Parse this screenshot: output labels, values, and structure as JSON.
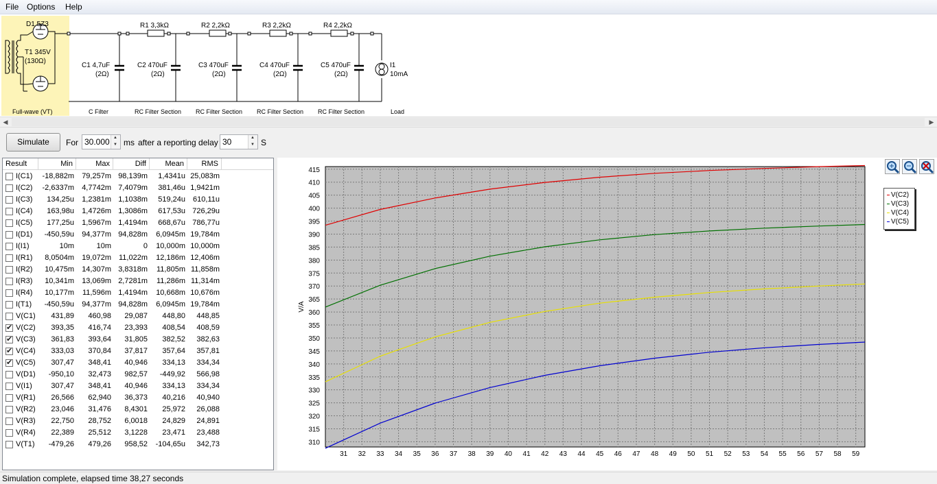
{
  "menu": {
    "items": [
      "File",
      "Options",
      "Help"
    ]
  },
  "schematic": {
    "rectifier": {
      "diode": "D1 5Z3",
      "transformer": "T1 345V",
      "transformer_r": "(130Ω)",
      "caption": "Full-wave (VT)"
    },
    "c1": {
      "name": "C1 4,7uF",
      "esr": "(2Ω)",
      "caption": "C Filter"
    },
    "sections": [
      {
        "resistor": "R1 3,3kΩ",
        "cap": "C2 470uF",
        "esr": "(2Ω)",
        "caption": "RC Filter Section"
      },
      {
        "resistor": "R2 2,2kΩ",
        "cap": "C3 470uF",
        "esr": "(2Ω)",
        "caption": "RC Filter Section"
      },
      {
        "resistor": "R3 2,2kΩ",
        "cap": "C4 470uF",
        "esr": "(2Ω)",
        "caption": "RC Filter Section"
      },
      {
        "resistor": "R4 2,2kΩ",
        "cap": "C5 470uF",
        "esr": "(2Ω)",
        "caption": "RC Filter Section"
      }
    ],
    "load": {
      "name": "I1",
      "value": "10mA",
      "caption": "Load"
    }
  },
  "toolbar": {
    "simulate_label": "Simulate",
    "for_label": "For",
    "duration_value": "30.000",
    "duration_unit": "ms",
    "delay_label": "after a reporting delay of",
    "delay_value": "30",
    "delay_unit": "S"
  },
  "table": {
    "columns": [
      "Result",
      "Min",
      "Max",
      "Diff",
      "Mean",
      "RMS"
    ],
    "rows": [
      {
        "name": "I(C1)",
        "min": "-18,882m",
        "max": "79,257m",
        "diff": "98,139m",
        "mean": "1,4341u",
        "rms": "25,083m",
        "checked": false
      },
      {
        "name": "I(C2)",
        "min": "-2,6337m",
        "max": "4,7742m",
        "diff": "7,4079m",
        "mean": "381,46u",
        "rms": "1,9421m",
        "checked": false
      },
      {
        "name": "I(C3)",
        "min": "134,25u",
        "max": "1,2381m",
        "diff": "1,1038m",
        "mean": "519,24u",
        "rms": "610,11u",
        "checked": false
      },
      {
        "name": "I(C4)",
        "min": "163,98u",
        "max": "1,4726m",
        "diff": "1,3086m",
        "mean": "617,53u",
        "rms": "726,29u",
        "checked": false
      },
      {
        "name": "I(C5)",
        "min": "177,25u",
        "max": "1,5967m",
        "diff": "1,4194m",
        "mean": "668,67u",
        "rms": "786,77u",
        "checked": false
      },
      {
        "name": "I(D1)",
        "min": "-450,59u",
        "max": "94,377m",
        "diff": "94,828m",
        "mean": "6,0945m",
        "rms": "19,784m",
        "checked": false
      },
      {
        "name": "I(I1)",
        "min": "10m",
        "max": "10m",
        "diff": "0",
        "mean": "10,000m",
        "rms": "10,000m",
        "checked": false
      },
      {
        "name": "I(R1)",
        "min": "8,0504m",
        "max": "19,072m",
        "diff": "11,022m",
        "mean": "12,186m",
        "rms": "12,406m",
        "checked": false
      },
      {
        "name": "I(R2)",
        "min": "10,475m",
        "max": "14,307m",
        "diff": "3,8318m",
        "mean": "11,805m",
        "rms": "11,858m",
        "checked": false
      },
      {
        "name": "I(R3)",
        "min": "10,341m",
        "max": "13,069m",
        "diff": "2,7281m",
        "mean": "11,286m",
        "rms": "11,314m",
        "checked": false
      },
      {
        "name": "I(R4)",
        "min": "10,177m",
        "max": "11,596m",
        "diff": "1,4194m",
        "mean": "10,668m",
        "rms": "10,676m",
        "checked": false
      },
      {
        "name": "I(T1)",
        "min": "-450,59u",
        "max": "94,377m",
        "diff": "94,828m",
        "mean": "6,0945m",
        "rms": "19,784m",
        "checked": false
      },
      {
        "name": "V(C1)",
        "min": "431,89",
        "max": "460,98",
        "diff": "29,087",
        "mean": "448,80",
        "rms": "448,85",
        "checked": false
      },
      {
        "name": "V(C2)",
        "min": "393,35",
        "max": "416,74",
        "diff": "23,393",
        "mean": "408,54",
        "rms": "408,59",
        "checked": true
      },
      {
        "name": "V(C3)",
        "min": "361,83",
        "max": "393,64",
        "diff": "31,805",
        "mean": "382,52",
        "rms": "382,63",
        "checked": true
      },
      {
        "name": "V(C4)",
        "min": "333,03",
        "max": "370,84",
        "diff": "37,817",
        "mean": "357,64",
        "rms": "357,81",
        "checked": true
      },
      {
        "name": "V(C5)",
        "min": "307,47",
        "max": "348,41",
        "diff": "40,946",
        "mean": "334,13",
        "rms": "334,34",
        "checked": true
      },
      {
        "name": "V(D1)",
        "min": "-950,10",
        "max": "32,473",
        "diff": "982,57",
        "mean": "-449,92",
        "rms": "566,98",
        "checked": false
      },
      {
        "name": "V(I1)",
        "min": "307,47",
        "max": "348,41",
        "diff": "40,946",
        "mean": "334,13",
        "rms": "334,34",
        "checked": false
      },
      {
        "name": "V(R1)",
        "min": "26,566",
        "max": "62,940",
        "diff": "36,373",
        "mean": "40,216",
        "rms": "40,940",
        "checked": false
      },
      {
        "name": "V(R2)",
        "min": "23,046",
        "max": "31,476",
        "diff": "8,4301",
        "mean": "25,972",
        "rms": "26,088",
        "checked": false
      },
      {
        "name": "V(R3)",
        "min": "22,750",
        "max": "28,752",
        "diff": "6,0018",
        "mean": "24,829",
        "rms": "24,891",
        "checked": false
      },
      {
        "name": "V(R4)",
        "min": "22,389",
        "max": "25,512",
        "diff": "3,1228",
        "mean": "23,471",
        "rms": "23,488",
        "checked": false
      },
      {
        "name": "V(T1)",
        "min": "-479,26",
        "max": "479,26",
        "diff": "958,52",
        "mean": "-104,65u",
        "rms": "342,73",
        "checked": false
      }
    ]
  },
  "chart_data": {
    "type": "line",
    "ylabel": "V/A",
    "xlim": [
      30,
      59.5
    ],
    "ylim": [
      308,
      416
    ],
    "xticks": [
      31,
      32,
      33,
      34,
      35,
      36,
      37,
      38,
      39,
      40,
      41,
      42,
      43,
      44,
      45,
      46,
      47,
      48,
      49,
      50,
      51,
      52,
      53,
      54,
      55,
      56,
      57,
      58,
      59
    ],
    "yticks": [
      310,
      315,
      320,
      325,
      330,
      335,
      340,
      345,
      350,
      355,
      360,
      365,
      370,
      375,
      380,
      385,
      390,
      395,
      400,
      405,
      410,
      415
    ],
    "grid": true,
    "legend_position": "right",
    "series": [
      {
        "name": "V(C2)",
        "color": "#e00000",
        "x": [
          30,
          33,
          36,
          39,
          42,
          45,
          48,
          51,
          54,
          57,
          59.5
        ],
        "y": [
          393.4,
          399.5,
          403.9,
          407.3,
          409.9,
          411.9,
          413.4,
          414.5,
          415.3,
          416.0,
          416.4
        ]
      },
      {
        "name": "V(C3)",
        "color": "#007000",
        "x": [
          30,
          33,
          36,
          39,
          42,
          45,
          48,
          51,
          54,
          57,
          59.5
        ],
        "y": [
          361.9,
          370.3,
          376.7,
          381.5,
          385.1,
          387.8,
          389.8,
          391.2,
          392.3,
          393.1,
          393.7
        ]
      },
      {
        "name": "V(C4)",
        "color": "#e8e000",
        "x": [
          30,
          33,
          36,
          39,
          42,
          45,
          48,
          51,
          54,
          57,
          59.5
        ],
        "y": [
          333.1,
          343.0,
          350.4,
          356.0,
          360.2,
          363.4,
          365.7,
          367.5,
          368.9,
          370.0,
          370.8
        ]
      },
      {
        "name": "V(C5)",
        "color": "#0000d0",
        "x": [
          30,
          33,
          36,
          39,
          42,
          45,
          48,
          51,
          54,
          57,
          59.5
        ],
        "y": [
          307.5,
          317.2,
          324.9,
          330.9,
          335.6,
          339.3,
          342.2,
          344.5,
          346.2,
          347.5,
          348.4
        ]
      }
    ]
  },
  "icons": {
    "zoom_in": "zoom-in-icon",
    "zoom_out": "zoom-out-icon",
    "zoom_reset": "zoom-reset-icon"
  },
  "status": {
    "text": "Simulation complete, elapsed time 38,27 seconds"
  }
}
